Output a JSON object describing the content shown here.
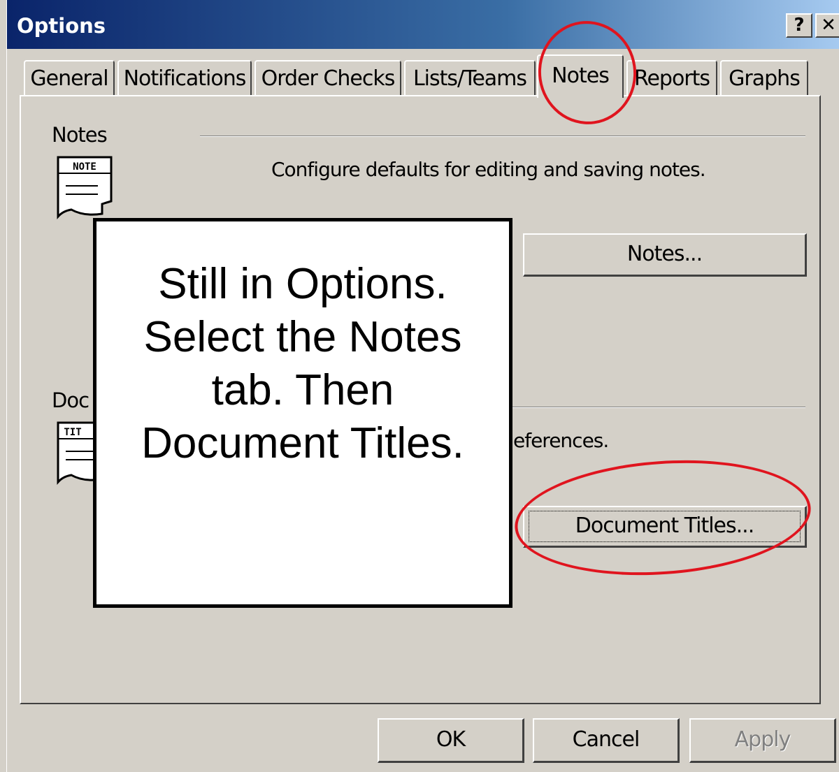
{
  "window": {
    "title": "Options",
    "help_glyph": "?",
    "close_glyph": "✕"
  },
  "tabs": [
    {
      "label": "General"
    },
    {
      "label": "Notifications"
    },
    {
      "label": "Order Checks"
    },
    {
      "label": "Lists/Teams"
    },
    {
      "label": "Notes",
      "active": true
    },
    {
      "label": "Reports"
    },
    {
      "label": "Graphs"
    }
  ],
  "notes_group": {
    "label": "Notes",
    "icon_text": "NOTE",
    "description": "Configure defaults for editing and saving notes.",
    "button_label": "Notes..."
  },
  "doc_group": {
    "label_visible": "Doc",
    "icon_text": "TIT",
    "description_visible": "eferences.",
    "button_label": "Document Titles..."
  },
  "footer": {
    "ok_label": "OK",
    "cancel_label": "Cancel",
    "apply_label": "Apply"
  },
  "annotation": {
    "lines": [
      "Still in Options.",
      "Select the Notes",
      "tab. Then",
      "Document Titles."
    ],
    "highlight_color": "#e0141e"
  }
}
